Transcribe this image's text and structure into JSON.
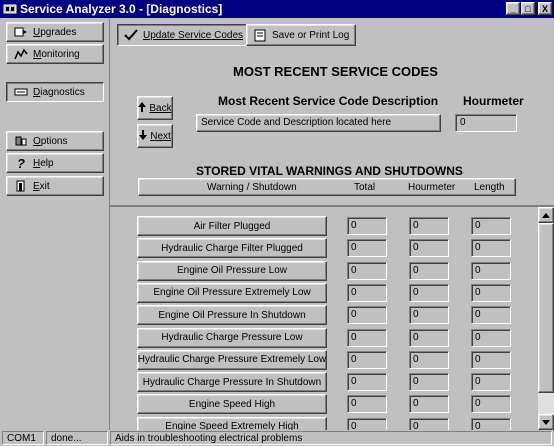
{
  "window": {
    "title": "Service Analyzer 3.0 - [Diagnostics]",
    "controls": [
      "_",
      "□",
      "X"
    ]
  },
  "sidebar": {
    "items": [
      {
        "label": "Upgrades",
        "icon": "upgrades-icon"
      },
      {
        "label": "Monitoring",
        "icon": "monitoring-icon"
      },
      {
        "label": "Diagnostics",
        "icon": "diagnostics-icon",
        "selected": true
      },
      {
        "label": "Options",
        "icon": "options-icon"
      },
      {
        "label": "Help",
        "icon": "help-icon"
      },
      {
        "label": "Exit",
        "icon": "exit-icon"
      }
    ]
  },
  "toolbar": {
    "update_label": "Update Service Codes",
    "save_label": "Save or Print Log"
  },
  "recent": {
    "heading": "MOST RECENT SERVICE CODES",
    "description_header": "Most Recent Service Code Description",
    "hourmeter_header": "Hourmeter",
    "back_label": "Back",
    "next_label": "Next",
    "description_value": "Service Code and Description located here",
    "hourmeter_value": "0"
  },
  "vital": {
    "heading": "STORED VITAL WARNINGS AND SHUTDOWNS",
    "columns": [
      "Warning / Shutdown",
      "Total",
      "Hourmeter",
      "Length"
    ],
    "rows": [
      {
        "label": "Air Filter Plugged",
        "total": "0",
        "hourmeter": "0",
        "length": "0"
      },
      {
        "label": "Hydraulic Charge Filter Plugged",
        "total": "0",
        "hourmeter": "0",
        "length": "0"
      },
      {
        "label": "Engine Oil Pressure Low",
        "total": "0",
        "hourmeter": "0",
        "length": "0"
      },
      {
        "label": "Engine Oil Pressure Extremely Low",
        "total": "0",
        "hourmeter": "0",
        "length": "0"
      },
      {
        "label": "Engine Oil Pressure In Shutdown",
        "total": "0",
        "hourmeter": "0",
        "length": "0"
      },
      {
        "label": "Hydraulic Charge Pressure Low",
        "total": "0",
        "hourmeter": "0",
        "length": "0"
      },
      {
        "label": "Hydraulic Charge Pressure Extremely Low",
        "total": "0",
        "hourmeter": "0",
        "length": "0"
      },
      {
        "label": "Hydraulic Charge Pressure In Shutdown",
        "total": "0",
        "hourmeter": "0",
        "length": "0"
      },
      {
        "label": "Engine Speed High",
        "total": "0",
        "hourmeter": "0",
        "length": "0"
      },
      {
        "label": "Engine Speed Extremely High",
        "total": "0",
        "hourmeter": "0",
        "length": "0"
      }
    ]
  },
  "status": {
    "port": "COM1",
    "state": "done...",
    "message": "Aids in troubleshooting electrical problems"
  },
  "colors": {
    "titlebar": "#000080",
    "face": "#c0c0c0"
  }
}
